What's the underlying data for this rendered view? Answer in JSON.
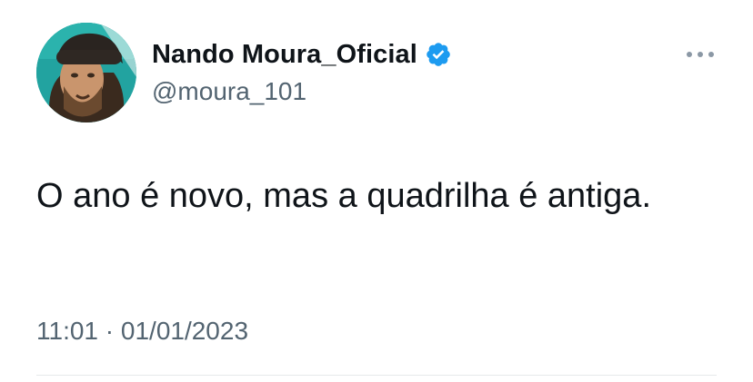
{
  "author": {
    "display_name": "Nando Moura_Oficial",
    "handle": "@moura_101",
    "verified": true,
    "verified_color": "#1d9bf0",
    "avatar_icon": "profile-photo"
  },
  "tweet": {
    "text": "O ano é novo, mas a quadrilha é antiga.",
    "time": "11:01",
    "separator": " · ",
    "date": "01/01/2023"
  },
  "actions": {
    "more_icon": "more-options-icon"
  },
  "colors": {
    "text": "#0f1419",
    "secondary": "#536471",
    "divider": "#e6e9eb"
  }
}
